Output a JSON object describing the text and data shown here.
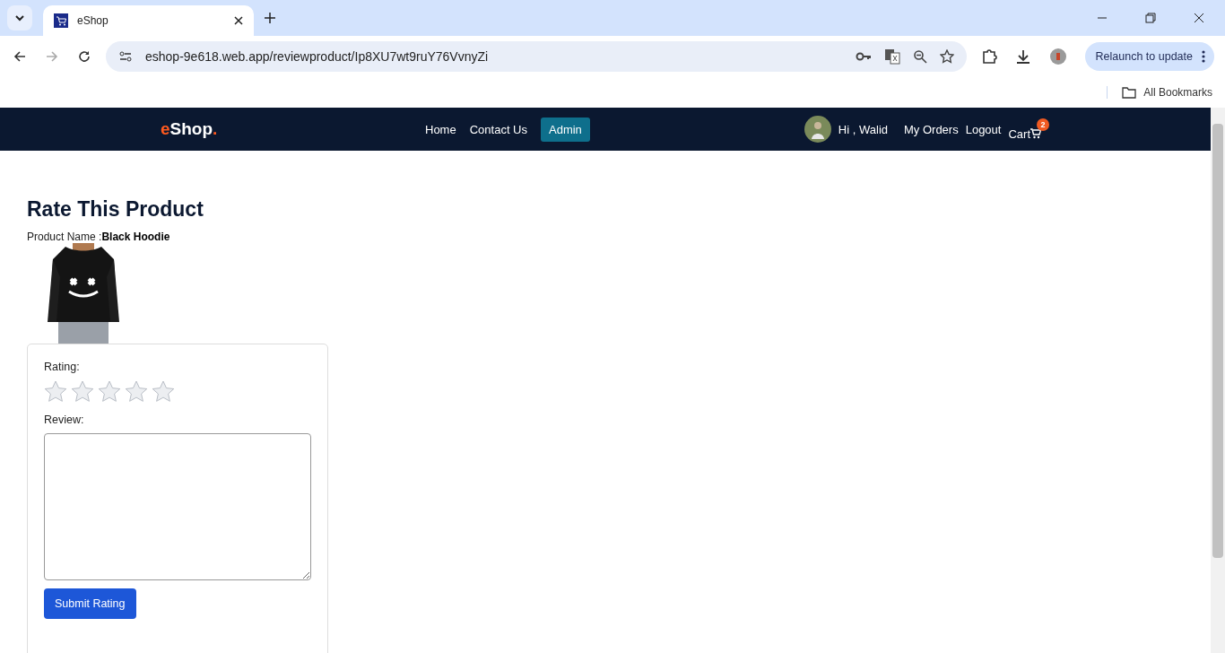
{
  "browser": {
    "tab_title": "eShop",
    "url": "eshop-9e618.web.app/reviewproduct/Ip8XU7wt9ruY76VvnyZi",
    "relaunch_label": "Relaunch to update",
    "bookmarks_label": "All Bookmarks"
  },
  "navbar": {
    "logo": "eShop",
    "logo_dot": ".",
    "links": [
      {
        "label": "Home",
        "selected": false
      },
      {
        "label": "Contact Us",
        "selected": false
      },
      {
        "label": "Admin",
        "selected": true
      }
    ],
    "greeting": "Hi , Walid",
    "right_links": [
      "My Orders",
      "Logout"
    ],
    "cart_label": "Cart",
    "cart_count": "2"
  },
  "page": {
    "title": "Rate This Product",
    "product_label": "Product Name :",
    "product_name": "Black Hoodie"
  },
  "form": {
    "rating_label": "Rating:",
    "stars": 0,
    "review_label": "Review:",
    "submit_label": "Submit Rating"
  }
}
